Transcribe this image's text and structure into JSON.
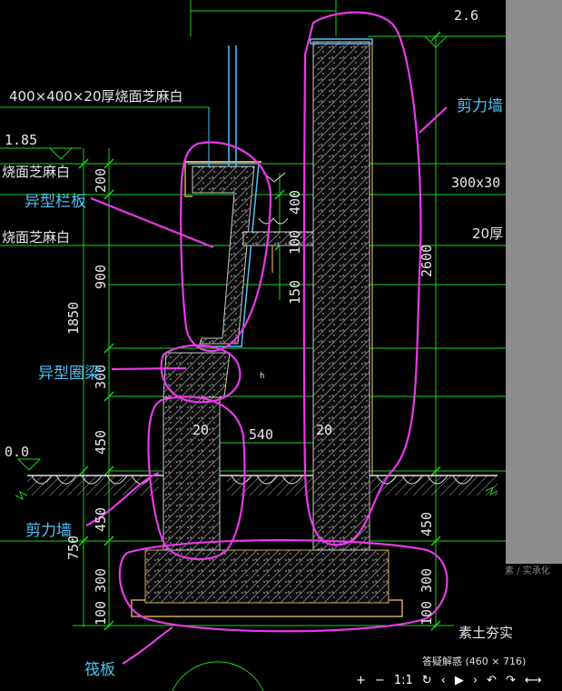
{
  "dimensions": {
    "top_right_elev": "2.6",
    "top_slab_spec": "400×400×20厚烧面芝麻白",
    "left_elev": "1.85",
    "left_note1": "烧面芝麻白",
    "left_note2": "烧面芝麻白",
    "right_note1": "300x30",
    "right_note2": "20厚",
    "ground_elev": "0.0",
    "v200": "200",
    "v900": "900",
    "v1850": "1850",
    "v300a": "300",
    "v450a": "450",
    "v450b": "450",
    "v750": "750",
    "v300b": "300",
    "v100a": "100",
    "v400": "400",
    "v100b": "100",
    "v150": "150",
    "v2600": "2600",
    "v450c": "450",
    "v300c": "300",
    "v100c": "100",
    "h540": "540",
    "t20a": "20",
    "t20b": "20",
    "small_mark": "h",
    "soil_label": "素土夯实",
    "faint_text": "素 / 实承化"
  },
  "annotations": {
    "shear_wall_top": "剪力墙",
    "special_rail": "异型栏板",
    "special_ring_beam": "异型圈梁",
    "shear_wall_bottom": "剪力墙",
    "raft": "筏板"
  },
  "viewer": {
    "size_caption": "答疑解惑 (460 × 716)",
    "zoom_in": "+",
    "zoom_out": "−",
    "actual_size": "1:1",
    "rotate": "↻",
    "prev": "‹",
    "play": "▶",
    "next": "›",
    "undo": "↶",
    "redo": "↷",
    "fit": "⟷"
  }
}
